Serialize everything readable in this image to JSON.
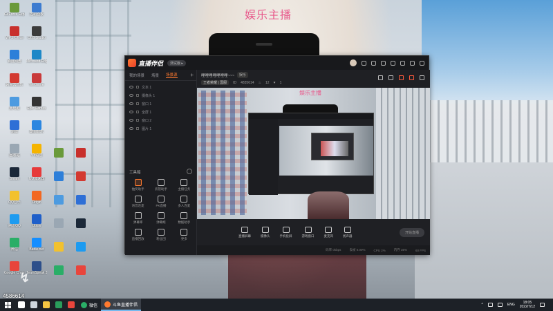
{
  "desktop": {
    "watermark": "娱乐主播",
    "bottom_number": "4586614",
    "icons": [
      {
        "label": "GeForce Experience",
        "color": "#6a9a3a"
      },
      {
        "label": "WPS Office",
        "color": "#c8302c"
      },
      {
        "label": "百度网盘",
        "color": "#2d7fd9"
      },
      {
        "label": "网易云音乐",
        "color": "#d33a31"
      },
      {
        "label": "此电脑",
        "color": "#4d9be0"
      },
      {
        "label": "迅雷",
        "color": "#2e6fd6"
      },
      {
        "label": "回收站",
        "color": "#9aa7b3"
      },
      {
        "label": "Steam",
        "color": "#1b2838"
      },
      {
        "label": "QQ音乐",
        "color": "#f2c12e"
      },
      {
        "label": "腾讯QQ",
        "color": "#1d9bf0"
      },
      {
        "label": "微信",
        "color": "#2aae67"
      },
      {
        "label": "Google Chrome",
        "color": "#e8453c"
      },
      {
        "label": "控制面板",
        "color": "#3c7bd0"
      },
      {
        "label": "OBS Studio",
        "color": "#3b3b3b"
      },
      {
        "label": "Microsoft Edge",
        "color": "#1e88c7"
      },
      {
        "label": "WeGame",
        "color": "#c93a3a"
      },
      {
        "label": "Epic Games",
        "color": "#333333"
      },
      {
        "label": "酷狗音乐",
        "color": "#2b86e0"
      },
      {
        "label": "YY语音",
        "color": "#f5b400"
      },
      {
        "label": "UU加速器",
        "color": "#e63a3a"
      },
      {
        "label": "Origin",
        "color": "#f26822"
      },
      {
        "label": "Uplay",
        "color": "#1f5fc9"
      },
      {
        "label": "Battle.net",
        "color": "#148eff"
      },
      {
        "label": "TeamSpeak 3",
        "color": "#2d4f8a"
      }
    ]
  },
  "app": {
    "brand": "直播伴侣",
    "version_badge": "测试版 ▸",
    "side_tabs": [
      "我的场景",
      "场景",
      "场景源"
    ],
    "side_tab_active_index": 2,
    "scenes": [
      {
        "label": "文本 1"
      },
      {
        "label": "摄像头 1"
      },
      {
        "label": "窗口 1"
      },
      {
        "label": "全屏 1"
      },
      {
        "label": "窗口 2"
      },
      {
        "label": "图片 1"
      }
    ],
    "tools_title": "工具箱",
    "tools": [
      {
        "label": "抽奖助手",
        "orange": true
      },
      {
        "label": "房管助手",
        "orange": false
      },
      {
        "label": "主播任务",
        "orange": false
      },
      {
        "label": "语音连麦",
        "orange": false
      },
      {
        "label": "PK直播",
        "orange": false
      },
      {
        "label": "多人连麦",
        "orange": false
      },
      {
        "label": "弹幕库",
        "orange": false
      },
      {
        "label": "弹幕姬",
        "orange": false
      },
      {
        "label": "数据助手",
        "orange": false
      },
      {
        "label": "直播回放",
        "orange": false
      },
      {
        "label": "粉丝团",
        "orange": false
      },
      {
        "label": "更多",
        "orange": false
      }
    ],
    "preview": {
      "title": "哩哩哩哩哩哩哩~~~",
      "chip": "娱乐",
      "category_tag": "王者荣耀 | 国服",
      "room_id": "4835614",
      "hot": "12",
      "fans": "1"
    },
    "canvas_watermark": "娱乐主播",
    "controls": [
      {
        "label": "直播屏幕"
      },
      {
        "label": "摄像头"
      },
      {
        "label": "手机投屏"
      },
      {
        "label": "游戏窗口"
      },
      {
        "label": "麦克风"
      },
      {
        "label": "扬声器"
      }
    ],
    "start_button": "开始直播",
    "status": [
      "码率 0kbps",
      "丢帧 0.00%",
      "CPU 2%",
      "内存 35%",
      "60 FPS"
    ]
  },
  "taskbar": {
    "tasks": [
      {
        "label": "微信",
        "color": "#2aae67",
        "active": false
      },
      {
        "label": "斗鱼直播伴侣",
        "color": "#ff7a2f",
        "active": true
      }
    ],
    "pinned": [
      {
        "name": "search-icon",
        "color": "#ffffff"
      },
      {
        "name": "task-view-icon",
        "color": "#cfd6dd"
      },
      {
        "name": "file-explorer-icon",
        "color": "#f5c542"
      },
      {
        "name": "shield-icon",
        "color": "#2a9d5b"
      },
      {
        "name": "browser-icon",
        "color": "#e8453c"
      }
    ],
    "ime": "ENG",
    "time": "18:05",
    "date": "2022/7/12"
  }
}
